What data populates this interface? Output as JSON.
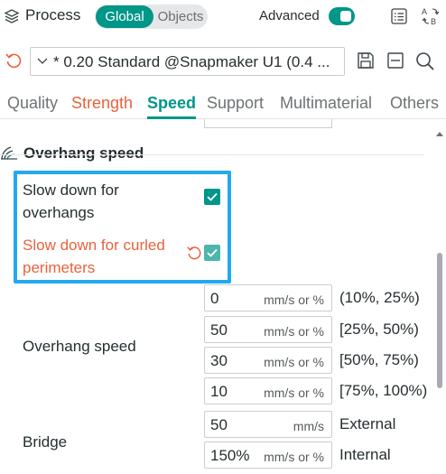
{
  "header": {
    "title": "Process",
    "segments": [
      "Global",
      "Objects"
    ],
    "advanced_label": "Advanced",
    "advanced_on": true,
    "icons": [
      "process-cube-icon",
      "list-icon",
      "compare-ab-icon"
    ]
  },
  "preset": {
    "value": "* 0.20 Standard @Snapmaker U1 (0.4 ...",
    "icons": [
      "reset-icon",
      "chevron-down-icon",
      "save-icon",
      "minus-box-icon",
      "search-icon"
    ]
  },
  "tabs": [
    {
      "label": "Quality"
    },
    {
      "label": "Strength"
    },
    {
      "label": "Speed"
    },
    {
      "label": "Support"
    },
    {
      "label": "Multimaterial"
    },
    {
      "label": "Others"
    }
  ],
  "section": {
    "title": "Overhang speed",
    "icon": "overhang-icon"
  },
  "options": [
    {
      "line1": "Slow down for",
      "line2": "overhangs",
      "checked": true
    },
    {
      "line1": "Slow down for curled",
      "line2": "perimeters",
      "checked": true,
      "modified": true
    }
  ],
  "overhang_speed": {
    "label": "Overhang speed",
    "rows": [
      {
        "value": "0",
        "unit": "mm/s or %",
        "range": "(10%, 25%)"
      },
      {
        "value": "50",
        "unit": "mm/s or %",
        "range": "[25%, 50%)"
      },
      {
        "value": "30",
        "unit": "mm/s or %",
        "range": "[50%, 75%)"
      },
      {
        "value": "10",
        "unit": "mm/s or %",
        "range": "[75%, 100%)"
      }
    ]
  },
  "bridge": {
    "label": "Bridge",
    "rows": [
      {
        "value": "50",
        "unit": "mm/s",
        "range": "External"
      },
      {
        "value": "150%",
        "unit": "mm/s or %",
        "range": "Internal"
      }
    ]
  },
  "colors": {
    "accent": "#009688",
    "modified": "#e8623d",
    "highlight": "#23a9f0"
  }
}
